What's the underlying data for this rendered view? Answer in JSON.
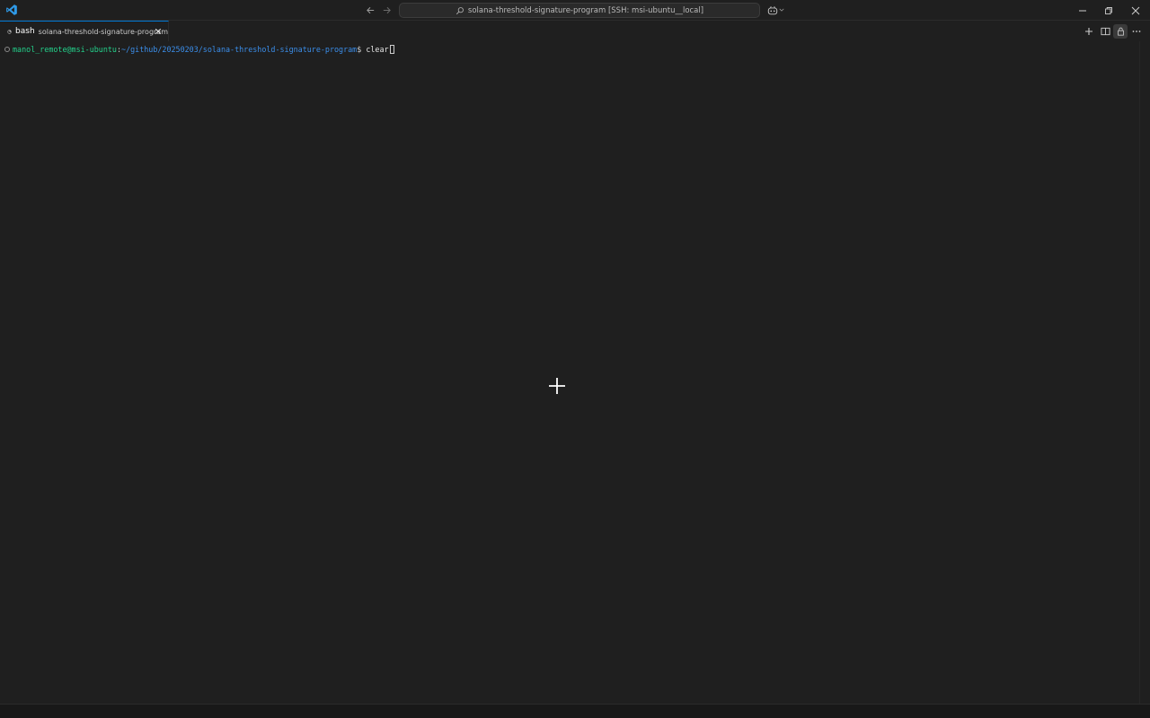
{
  "titlebar": {
    "command_center_text": "solana-threshold-signature-program [SSH: msi-ubuntu__local]",
    "icons": [
      "vscode-logo",
      "back-arrow",
      "forward-arrow",
      "search",
      "copilot",
      "chevron-down",
      "minimize",
      "restore",
      "close"
    ]
  },
  "terminal_tab": {
    "title": "bash",
    "description": "solana-threshold-signature-program"
  },
  "terminal": {
    "prompt_user": "manol_remote@msi-ubuntu",
    "prompt_colon": ":",
    "prompt_path": "~/github/20250203/solana-threshold-signature-program",
    "prompt_symbol": "$ ",
    "command": "clear"
  },
  "colors": {
    "background": "#1f1f1f",
    "accent": "#0078d4",
    "prompt_user": "#23d18b",
    "prompt_path": "#3b8eea"
  }
}
